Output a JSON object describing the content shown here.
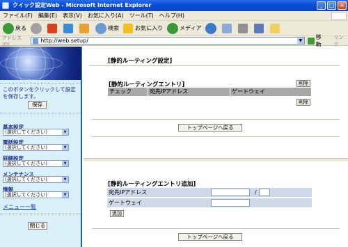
{
  "window": {
    "title": "クイック設定Web - Microsoft Internet Explorer",
    "buttons": {
      "minimize": "_",
      "maximize": "□",
      "close": "×"
    }
  },
  "menubar": {
    "items": [
      "ファイル(F)",
      "編集(E)",
      "表示(V)",
      "お気に入り(A)",
      "ツール(T)",
      "ヘルプ(H)"
    ]
  },
  "toolbar": {
    "back": "戻る",
    "search": "検索",
    "favorites": "お気に入り",
    "media": "メディア"
  },
  "address": {
    "label": "アドレス(D)",
    "url": "http://web.setup/",
    "go": "移動",
    "links": "リンク"
  },
  "sidebar": {
    "save_hint": "このボタンをクリックして設定を保存します。",
    "save_button": "保存",
    "categories": [
      {
        "label": "基本設定",
        "select": "(選択してください)"
      },
      {
        "label": "電話設定",
        "select": "(選択してください)"
      },
      {
        "label": "詳細設定",
        "select": "(選択してください)"
      },
      {
        "label": "メンテナンス",
        "select": "(選択してください)"
      },
      {
        "label": "情報",
        "select": "(選択してください)"
      }
    ],
    "menu_list": "メニュー一覧",
    "close_button": "閉じる"
  },
  "top": {
    "page_title": "[静的ルーティング設定]",
    "entry_title": "[静的ルーティングエントリ]",
    "delete_button": "削除",
    "columns": [
      "チェック",
      "宛先IPアドレス",
      "ゲートウェイ"
    ],
    "back_button": "トップページへ戻る"
  },
  "bottom": {
    "add_title": "[静的ルーティングエントリ追加]",
    "dest_label": "宛先IPアドレス",
    "slash": "/",
    "gateway_label": "ゲートウェイ",
    "add_button": "追加",
    "back_button": "トップページへ戻る"
  }
}
